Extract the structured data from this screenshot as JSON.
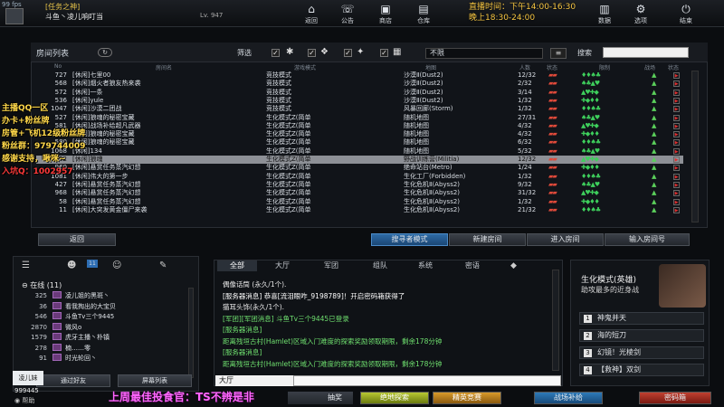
{
  "top": {
    "fps": "99 fps",
    "tag": "[任务之神]",
    "player": "斗鱼丶凌儿响叮当",
    "level": "Lv. 947",
    "nav": [
      {
        "label": "返回",
        "icon": "home-icon"
      },
      {
        "label": "公告",
        "icon": "megaphone-icon"
      },
      {
        "label": "商店",
        "icon": "shop-icon"
      },
      {
        "label": "仓库",
        "icon": "warehouse-icon"
      },
      {
        "label": "数据",
        "icon": "chart-icon"
      },
      {
        "label": "选项",
        "icon": "gear-icon"
      },
      {
        "label": "结束",
        "icon": "power-icon"
      }
    ],
    "live_line1": "直播时间：下午14:00-16:30",
    "live_line2": "晚上18:30-24:00"
  },
  "overlay_left": [
    "主播QQ一区",
    "办卡+粉丝牌",
    "房管+飞机12级粉丝牌",
    "粉丝群：979744009",
    "感谢支持，啾咪~",
    "入坑Q：1002957"
  ],
  "room_list": {
    "title": "房间列表",
    "filter_label": "筛选",
    "filter_value": "不限",
    "search_label": "搜索",
    "headers": [
      "No",
      "房间名",
      "游戏模式",
      "地图",
      "人数",
      "状态",
      "限制",
      "战场",
      "状态"
    ],
    "rows": [
      {
        "no": "727",
        "name": "[休闲]七里00",
        "mode": "竞技模式",
        "map": "沙漠Ⅱ(Dust2)",
        "count": "12/32"
      },
      {
        "no": "568",
        "name": "[休闲]烟火者狼友热来袭",
        "mode": "竞技模式",
        "map": "沙漠Ⅱ(Dust2)",
        "count": "2/32"
      },
      {
        "no": "572",
        "name": "[休闲]一条",
        "mode": "竞技模式",
        "map": "沙漠Ⅱ(Dust2)",
        "count": "3/14"
      },
      {
        "no": "536",
        "name": "[休闲]yule",
        "mode": "竞技模式",
        "map": "沙漠Ⅱ(Dust2)",
        "count": "1/32"
      },
      {
        "no": "1047",
        "name": "[休闲]沙漠二团战",
        "mode": "竞技模式",
        "map": "风暴回廊(Storm)",
        "count": "1/32"
      },
      {
        "no": "527",
        "name": "[休闲]狼魂的秘密宝藏",
        "mode": "生化模式Z(简单",
        "map": "随机地图",
        "count": "27/31"
      },
      {
        "no": "581",
        "name": "[休闲]战场补给超凡武器",
        "mode": "生化模式Z(简单",
        "map": "随机地图",
        "count": "4/32"
      },
      {
        "no": "507",
        "name": "[休闲]狼魂的秘密宝藏",
        "mode": "生化模式Z(简单",
        "map": "随机地图",
        "count": "4/32"
      },
      {
        "no": "580",
        "name": "[休闲]狼魂的秘密宝藏",
        "mode": "生化模式Z(简单",
        "map": "随机地图",
        "count": "6/32"
      },
      {
        "no": "1068",
        "name": "[休闲]134",
        "mode": "生化模式Z(简单",
        "map": "随机地图",
        "count": "5/32"
      },
      {
        "no": "1032",
        "name": "[休闲]狼魂",
        "mode": "生化模式Z(简单",
        "map": "野战训练营(Militia)",
        "count": "12/32"
      },
      {
        "no": "960",
        "name": "[休闲]悬赏任务蒸汽幻想",
        "mode": "生化模式Z(简单",
        "map": "绝命站台(Metro)",
        "count": "1/24"
      },
      {
        "no": "1081",
        "name": "[休闲]伟大的第一步",
        "mode": "生化模式Z(简单",
        "map": "生化工厂(Forbidden)",
        "count": "1/32"
      },
      {
        "no": "427",
        "name": "[休闲]悬赏任务蒸汽幻想",
        "mode": "生化模式Z(简单",
        "map": "生化危机Ⅱ(Abyss2)",
        "count": "9/32"
      },
      {
        "no": "968",
        "name": "[休闲]悬赏任务蒸汽幻想",
        "mode": "生化模式Z(简单",
        "map": "生化危机Ⅱ(Abyss2)",
        "count": "31/32"
      },
      {
        "no": "58",
        "name": "[休闲]悬赏任务蒸汽幻想",
        "mode": "生化模式Z(简单",
        "map": "生化危机Ⅱ(Abyss2)",
        "count": "1/32"
      },
      {
        "no": "11",
        "name": "[休闲]大突发黄金僵尸来袭",
        "mode": "生化模式Z(简单",
        "map": "生化危机Ⅱ(Abyss2)",
        "count": "21/32"
      }
    ],
    "selected_index": 10,
    "buttons": {
      "back": "返回",
      "quick": "搜寻者模式",
      "new": "新建房间",
      "enter": "进入房间",
      "input": "输入房间号"
    }
  },
  "friends": {
    "header": "在线 (11)",
    "items": [
      {
        "num": "325",
        "name": "凌儿姐的黑斑丶"
      },
      {
        "num": "36",
        "name": "看我掏出的大宝贝"
      },
      {
        "num": "546",
        "name": "斗鱼Tv三个9445"
      },
      {
        "num": "2870",
        "name": "微风o"
      },
      {
        "num": "1579",
        "name": "虎牙主播丶朴镇"
      },
      {
        "num": "278",
        "name": "楠……零"
      },
      {
        "num": "91",
        "name": "时光轮回丶"
      }
    ],
    "add_label": "通过好友",
    "list_label": "屏幕列表",
    "bottom_name": "凌儿妹",
    "bottom_num": "999445",
    "help": "帮助",
    "tab_badge": "11"
  },
  "chat": {
    "tabs": [
      "全部",
      "大厅",
      "军团",
      "组队",
      "系统",
      "密语"
    ],
    "lines": [
      {
        "t": "偶像话筒 (永久/1个).",
        "c": "#e8e8e8"
      },
      {
        "t": "[服务器消息] 恭喜[流泪眼咋_9198789]！开启密码箱获得了",
        "c": "#ffffff"
      },
      {
        "t": "猫耳头饰(永久/1个).",
        "c": "#e8e8e8"
      },
      {
        "t": "[军团][军团消息] 斗鱼Tv三个9445已登录",
        "c": "#6fe06f"
      },
      {
        "t": "[服务器消息]",
        "c": "#6fe06f"
      },
      {
        "t": "距离残垣古村(Hamlet)区域入门难度的探索奖励领取期限，剩余178分钟",
        "c": "#6fe06f"
      },
      {
        "t": "[服务器消息]",
        "c": "#6fe06f"
      },
      {
        "t": "距离残垣古村(Hamlet)区域入门难度的探索奖励领取期限，剩余178分钟",
        "c": "#6fe06f"
      }
    ],
    "channel": "大厅"
  },
  "right": {
    "mode": "生化模式(英雄)",
    "subtitle": "助攻最多的近身战",
    "skills": [
      {
        "k": "1",
        "t": "神鬼并天"
      },
      {
        "k": "2",
        "t": "海的短刀"
      },
      {
        "k": "3",
        "t": "幻镜！光棱剑"
      },
      {
        "k": "4",
        "t": "【救神】双剑"
      }
    ]
  },
  "bottom": {
    "banner": "上周最佳投食官：TS不辨是非",
    "buttons": [
      "抽奖",
      "绝地探索",
      "精英竞赛",
      "战场补给",
      "密码箱"
    ]
  }
}
